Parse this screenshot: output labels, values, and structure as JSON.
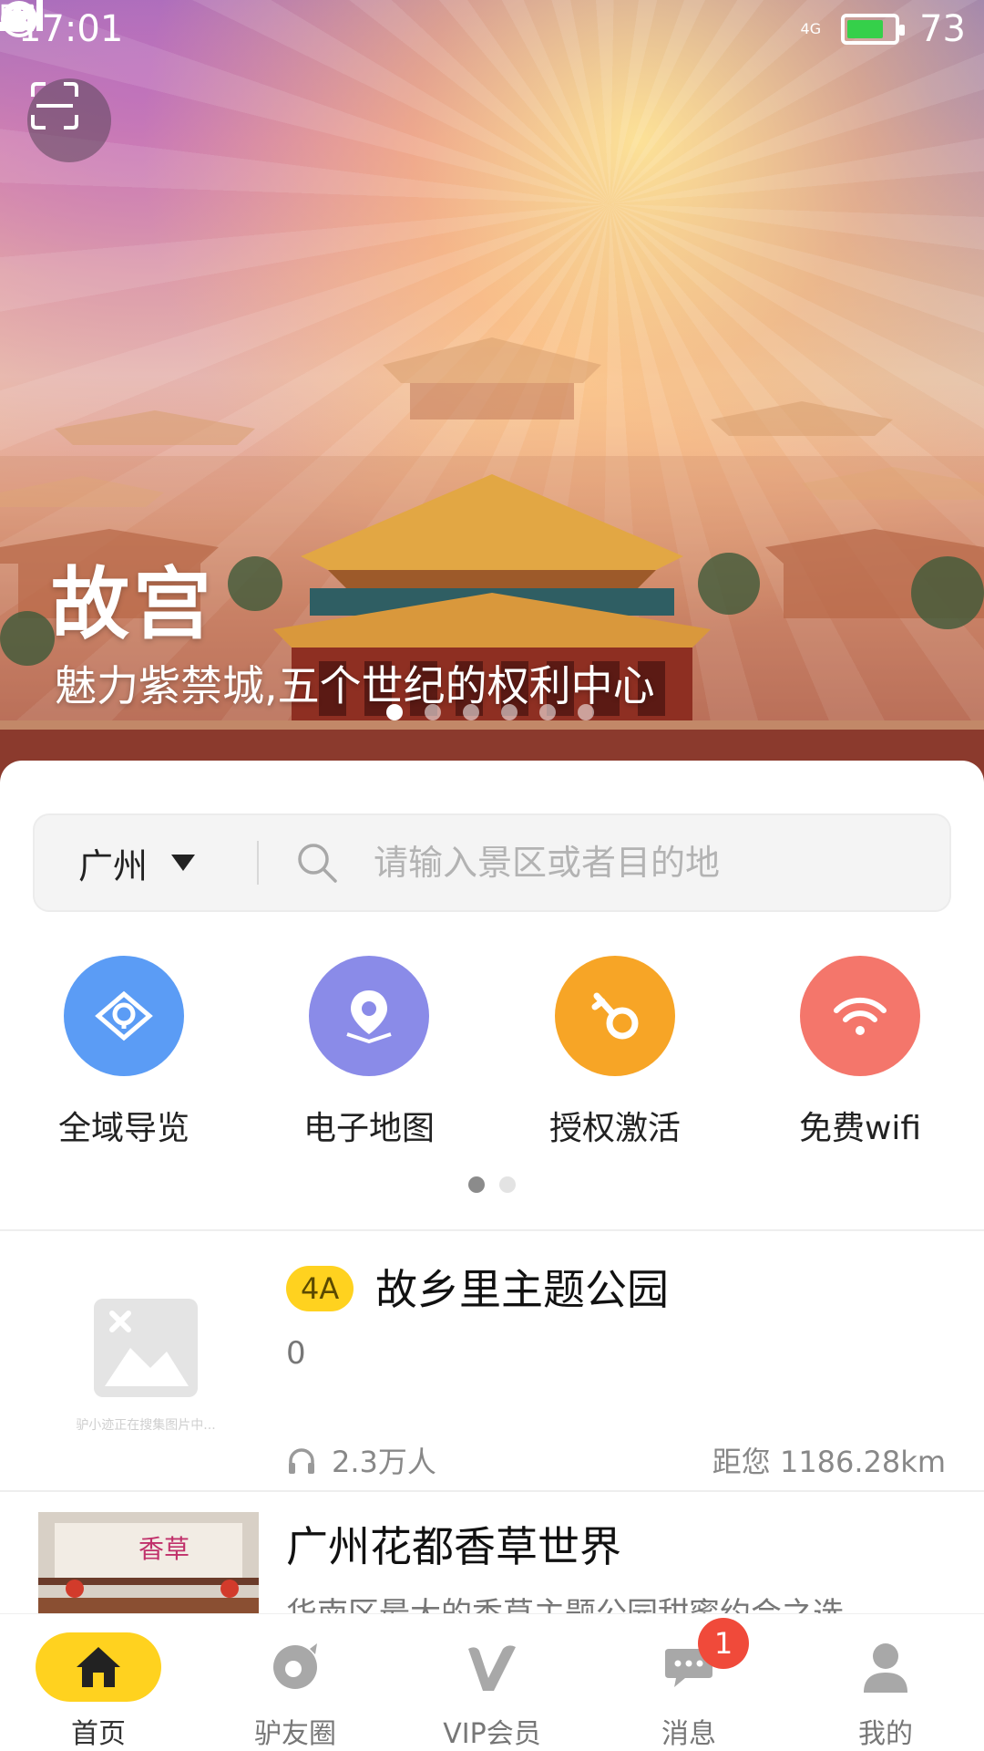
{
  "status_bar": {
    "time": "17:01",
    "battery_percent": "73",
    "network_label": "4G",
    "battery_color": "#35d04a"
  },
  "hero": {
    "title": "故宫",
    "subtitle": "魅力紫禁城,五个世纪的权利中心",
    "slide_count": 6,
    "active_slide": 1
  },
  "search": {
    "city": "广州",
    "placeholder": "请输入景区或者目的地"
  },
  "features": [
    {
      "label": "全域导览",
      "icon": "guide-icon",
      "color": "#5b9cf5"
    },
    {
      "label": "电子地图",
      "icon": "map-pin-icon",
      "color": "#8a8be8"
    },
    {
      "label": "授权激活",
      "icon": "key-icon",
      "color": "#f7a526"
    },
    {
      "label": "免费wifi",
      "icon": "wifi-icon",
      "color": "#f4766b"
    }
  ],
  "feature_pages": {
    "count": 2,
    "active": 1
  },
  "list": [
    {
      "badge": "4A",
      "title": "故乡里主题公园",
      "desc": "0",
      "thumb_caption": "驴小迹正在搜集图片中...",
      "listeners": "2.3万人",
      "distance": "距您 1186.28km"
    },
    {
      "title": "广州花都香草世界",
      "desc": "华南区最大的香草主题公园甜蜜约会之选——"
    }
  ],
  "bottom_nav": [
    {
      "label": "首页",
      "icon": "home-icon",
      "active": true
    },
    {
      "label": "驴友圈",
      "icon": "circle-icon"
    },
    {
      "label": "VIP会员",
      "icon": "vip-icon"
    },
    {
      "label": "消息",
      "icon": "message-icon",
      "badge": "1"
    },
    {
      "label": "我的",
      "icon": "profile-icon"
    }
  ],
  "colors": {
    "accent": "#ffd21f",
    "badge_red": "#f04a3a"
  }
}
